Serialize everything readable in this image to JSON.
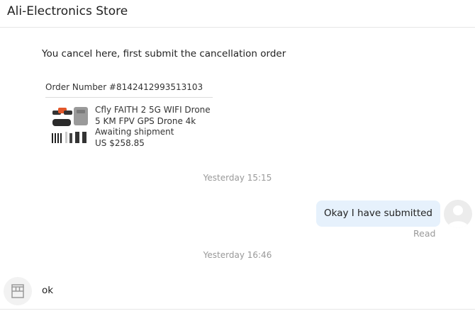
{
  "header": {
    "title": "Ali-Electronics Store"
  },
  "messages": {
    "incoming_text": "You cancel here, first submit the cancellation order",
    "order": {
      "number": "Order Number #8142412993513103",
      "product_name": "Cfly FAITH 2 5G WIFI Drone 5 KM FPV GPS Drone 4k Profe...",
      "status": "Awaiting shipment",
      "price": "US $258.85"
    },
    "timestamp_1": "Yesterday 15:15",
    "outgoing_text": "Okay I have submitted",
    "read_status": "Read",
    "timestamp_2": "Yesterday 16:46",
    "incoming_reply": "ok"
  },
  "colors": {
    "outgoing_bubble": "#e6f1fc",
    "timestamp": "#999999"
  },
  "icons": {
    "user_avatar": "person-icon",
    "store_avatar": "store-icon"
  }
}
